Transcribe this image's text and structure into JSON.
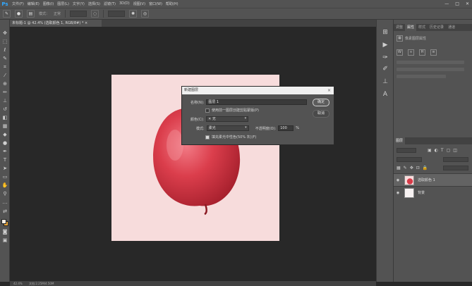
{
  "app": {
    "logo": "Ps"
  },
  "menu": [
    {
      "label": "文件(F)"
    },
    {
      "label": "编辑(E)"
    },
    {
      "label": "图像(I)"
    },
    {
      "label": "图层(L)"
    },
    {
      "label": "文字(Y)"
    },
    {
      "label": "选择(S)"
    },
    {
      "label": "滤镜(T)"
    },
    {
      "label": "3D(D)"
    },
    {
      "label": "视图(V)"
    },
    {
      "label": "窗口(W)"
    },
    {
      "label": "帮助(H)"
    }
  ],
  "window_controls": {
    "minimize": "—",
    "maximize": "□",
    "close": "✕"
  },
  "options_bar": {
    "mode_label": "模式：",
    "mode_value": "正常"
  },
  "document": {
    "tab_title": "未标题-1 @ 42.4% (选取颜色 1, RGB/8#) *",
    "close": "×"
  },
  "status_bar": {
    "zoom": "42.4%",
    "doc_size": "文档:2.25M/4.50M"
  },
  "dialog": {
    "title": "新建图层",
    "close": "×",
    "name_label": "名称(N):",
    "name_value": "图层 1",
    "clip_label": "使用前一图层创建剪贴蒙版(P)",
    "clip_checked": false,
    "color_label": "颜色(C):",
    "color_value": "无",
    "mode_label": "模式:",
    "mode_value": "柔光",
    "opacity_label": "不透明度(O):",
    "opacity_value": "100",
    "opacity_unit": "%",
    "fill_label": "填充柔光中性色(50% 灰)(F)",
    "fill_checked": true,
    "ok_label": "确定",
    "cancel_label": "取消"
  },
  "right_panel": {
    "top_tabs": [
      "调整",
      "属性",
      "样式",
      "历史记录",
      "通道"
    ],
    "active_top_tab": 1,
    "properties_title": "像素图层属性",
    "layers_tabs": [
      "图层"
    ],
    "layers": [
      {
        "name": "选取颜色 1",
        "selected": true,
        "visible": true,
        "thumb": "apple"
      },
      {
        "name": "背景",
        "selected": false,
        "visible": true,
        "thumb": "blank"
      }
    ]
  },
  "colors": {
    "canvas_bg": "#f7dcdc",
    "apple_red": "#d83a48",
    "foreground": "#f4ede4",
    "background": "#e9a53a"
  }
}
